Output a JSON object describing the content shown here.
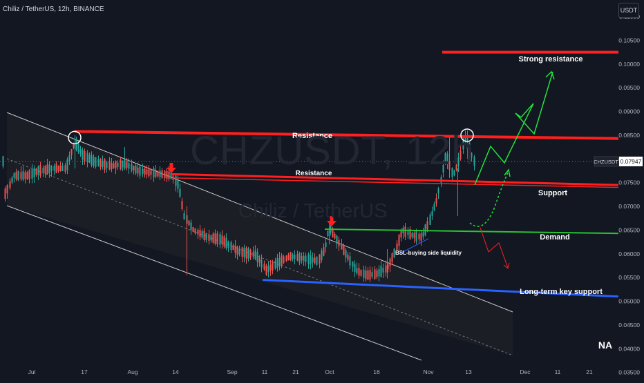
{
  "header": {
    "title": "Chiliz / TetherUS, 12h, BINANCE",
    "currency_button": "USDT"
  },
  "watermark": {
    "symbol": "CHZUSDT, 12h",
    "name": "Chiliz / TetherUS"
  },
  "price_tag": {
    "symbol": "CHZUSDT",
    "value": "0.07947"
  },
  "corner_label": "NA",
  "colors": {
    "background": "#131722",
    "up": "#26a69a",
    "down": "#ef5350",
    "resistance": "#ff1f1f",
    "support_blue": "#2962ff",
    "demand_green": "#26c531",
    "projection_green": "#22e33a",
    "projection_red": "#ff2020",
    "axis_text": "#b2b5be"
  },
  "chart_data": {
    "type": "candlestick",
    "title": "Chiliz / TetherUS, 12h, BINANCE",
    "y_axis": {
      "min": 0.0335,
      "max": 0.1135,
      "ticks": [
        "0.11000",
        "0.10500",
        "0.10000",
        "0.09500",
        "0.09000",
        "0.08500",
        "0.08000",
        "0.07500",
        "0.07000",
        "0.06500",
        "0.06000",
        "0.05500",
        "0.05000",
        "0.04500",
        "0.04000",
        "0.03500"
      ]
    },
    "x_axis": {
      "ticks": [
        "Jul",
        "17",
        "Aug",
        "14",
        "Sep",
        "11",
        "21",
        "Oct",
        "16",
        "Nov",
        "13",
        "Dec",
        "11",
        "21"
      ]
    },
    "grid": false,
    "last_price": 0.07947,
    "annotations": [
      {
        "text": "Resistance",
        "kind": "label"
      },
      {
        "text": "Resistance",
        "kind": "label"
      },
      {
        "text": "Strong resistance",
        "kind": "label"
      },
      {
        "text": "Support",
        "kind": "label"
      },
      {
        "text": "Demand",
        "kind": "label"
      },
      {
        "text": "Long-term key support",
        "kind": "label"
      },
      {
        "text": "BSL-buying side liquidity",
        "kind": "label"
      }
    ],
    "levels": [
      {
        "name": "Strong resistance",
        "price": 0.1025
      },
      {
        "name": "Resistance",
        "from": 0.0858,
        "to": 0.0843
      },
      {
        "name": "Resistance",
        "from": 0.0768,
        "to": 0.0745
      },
      {
        "name": "Support",
        "from": 0.076,
        "to": 0.074
      },
      {
        "name": "Demand",
        "from": 0.0652,
        "to": 0.0643
      },
      {
        "name": "Long-term key support",
        "from": 0.0545,
        "to": 0.051
      }
    ]
  }
}
